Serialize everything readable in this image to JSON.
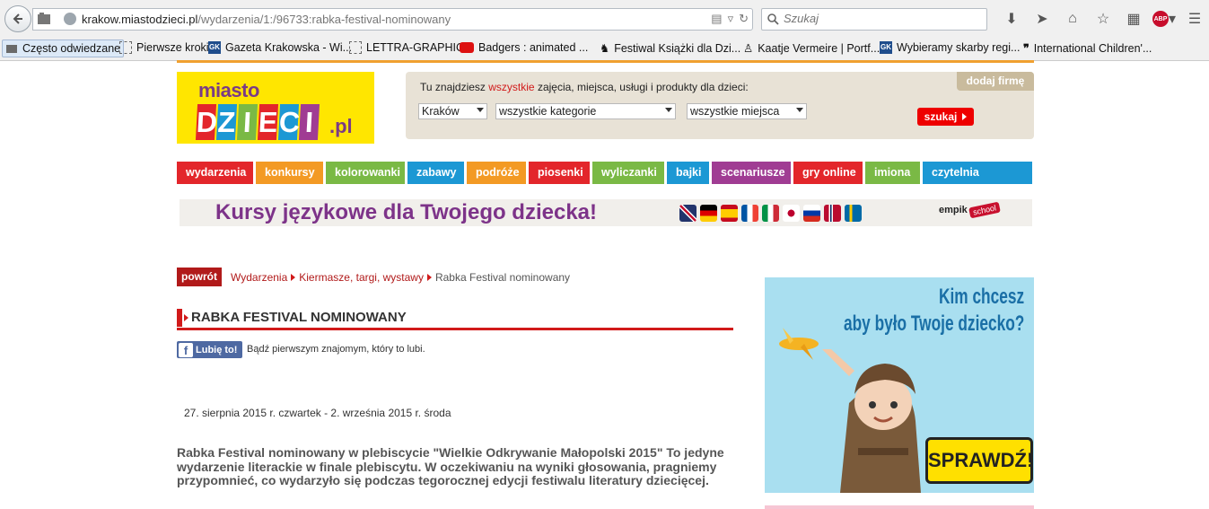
{
  "browser": {
    "url_domain": "krakow.miastodzieci.pl",
    "url_path": "/wydarzenia/1:/96733:rabka-festival-nominowany",
    "search_placeholder": "Szukaj",
    "abp_label": "ABP"
  },
  "bookmarks": [
    {
      "label": "Często odwiedzane",
      "icon": "folder-icon"
    },
    {
      "label": "Pierwsze kroki",
      "icon": "page-icon"
    },
    {
      "label": "Gazeta Krakowska - Wi...",
      "icon": "gk-icon"
    },
    {
      "label": "LETTRA-GRAPHIC",
      "icon": "page-icon"
    },
    {
      "label": "Badgers : animated ...",
      "icon": "youtube-icon"
    },
    {
      "label": "Festiwal Książki dla Dzi...",
      "icon": "horse-icon"
    },
    {
      "label": "Kaatje Vermeire | Portf...",
      "icon": "figure-icon"
    },
    {
      "label": "Wybieramy skarby regi...",
      "icon": "gk-icon"
    },
    {
      "label": "International Children'...",
      "icon": "quote-icon"
    }
  ],
  "logo": {
    "top": "miasto",
    "letters": [
      "D",
      "Z",
      "I",
      "E",
      "C",
      "I"
    ],
    "suffix": ".pl"
  },
  "search": {
    "intro_before": "Tu znajdziesz ",
    "intro_highlight": "wszystkie",
    "intro_after": " zajęcia, miejsca, usługi i produkty dla dzieci:",
    "add_firm": "dodaj firmę",
    "city": "Kraków",
    "category": "wszystkie kategorie",
    "place": "wszystkie miejsca",
    "button": "szukaj"
  },
  "nav": [
    {
      "label": "wydarzenia",
      "color": "#e3262b"
    },
    {
      "label": "konkursy",
      "color": "#f39a24"
    },
    {
      "label": "kolorowanki",
      "color": "#7ab945"
    },
    {
      "label": "zabawy",
      "color": "#1c98d4"
    },
    {
      "label": "podróże",
      "color": "#f39a24"
    },
    {
      "label": "piosenki",
      "color": "#e3262b"
    },
    {
      "label": "wyliczanki",
      "color": "#7ab945"
    },
    {
      "label": "bajki",
      "color": "#1c98d4"
    },
    {
      "label": "scenariusze",
      "color": "#a03c93"
    },
    {
      "label": "gry online",
      "color": "#e3262b"
    },
    {
      "label": "imiona",
      "color": "#7ab945"
    },
    {
      "label": "czytelnia",
      "color": "#1c98d4"
    }
  ],
  "banner": {
    "text": "Kursy językowe dla  Twojego dziecka!",
    "brand": "empik",
    "brand_tag": "school"
  },
  "breadcrumb": {
    "back": "powrót",
    "items": [
      "Wydarzenia",
      "Kiermasze, targi, wystawy"
    ],
    "current": "Rabka Festival nominowany"
  },
  "article": {
    "title": "RABKA FESTIVAL NOMINOWANY",
    "like_button": "Lubię to!",
    "like_text": "Bądź pierwszym znajomym, który to lubi.",
    "dates": "27. sierpnia 2015 r. czwartek - 2. września 2015 r. środa",
    "lead": "Rabka Festival nominowany w plebiscycie \"Wielkie Odkrywanie Małopolski 2015\" To jedyne wydarzenie literackie w finale plebiscytu. W oczekiwaniu na wyniki głosowania, pragniemy przypomnieć, co wydarzyło się podczas tegorocznej edycji festiwalu literatury dziecięcej."
  },
  "ad": {
    "line1": "Kim chcesz",
    "line2": "aby było Twoje dziecko?",
    "cta": "SPRAWDŹ!"
  }
}
